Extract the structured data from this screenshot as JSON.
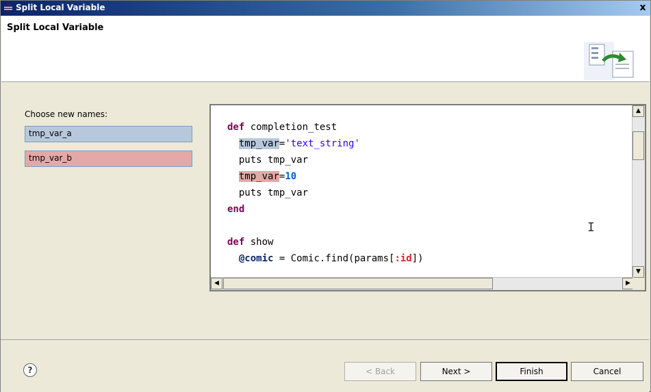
{
  "window": {
    "title": "Split Local Variable",
    "close_label": "x"
  },
  "banner": {
    "heading": "Split Local Variable",
    "icon": "refactor-wizard-icon"
  },
  "names": {
    "label": "Choose new names:",
    "field_a": "tmp_var_a",
    "field_b": "tmp_var_b"
  },
  "editor": {
    "lines": [
      "def completion_test",
      "  tmp_var='text_string'",
      "  puts tmp_var",
      "  tmp_var=10",
      "  puts tmp_var",
      "end",
      "",
      "def show",
      "  @comic = Comic.find(params[:id])"
    ],
    "cursor_glyph": "I"
  },
  "footer": {
    "help_icon": "?",
    "back_label": "< Back",
    "next_label": "Next >",
    "finish_label": "Finish",
    "cancel_label": "Cancel"
  },
  "colors": {
    "highlight_a": "#b8c8dc",
    "highlight_b": "#e4a8a8",
    "keyword": "#7f0055"
  }
}
